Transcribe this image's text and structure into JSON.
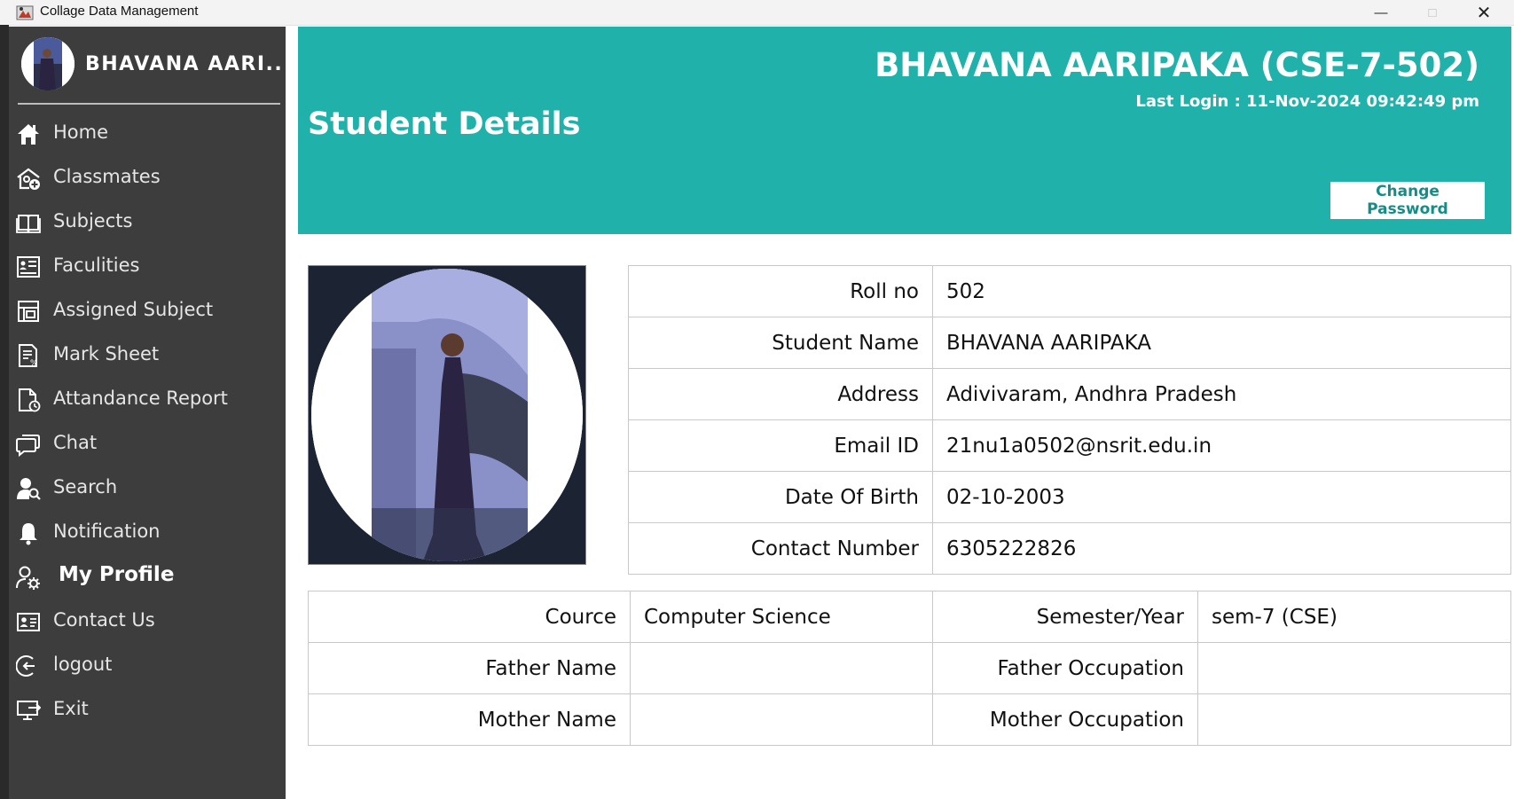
{
  "window": {
    "title": "Collage Data Management"
  },
  "sidebar": {
    "user_name": "BHAVANA AARI...",
    "items": [
      {
        "label": "Home",
        "icon": "home-icon"
      },
      {
        "label": "Classmates",
        "icon": "classmates-icon"
      },
      {
        "label": "Subjects",
        "icon": "book-icon"
      },
      {
        "label": "Faculities",
        "icon": "faculty-list-icon"
      },
      {
        "label": "Assigned Subject",
        "icon": "assigned-subject-icon"
      },
      {
        "label": "Mark Sheet",
        "icon": "mark-sheet-icon"
      },
      {
        "label": "Attandance Report",
        "icon": "report-icon"
      },
      {
        "label": "Chat",
        "icon": "chat-icon"
      },
      {
        "label": "Search",
        "icon": "user-search-icon"
      },
      {
        "label": "Notification",
        "icon": "bell-icon"
      },
      {
        "label": "My Profile",
        "icon": "user-settings-icon",
        "active": true
      },
      {
        "label": "Contact Us",
        "icon": "contact-card-icon"
      },
      {
        "label": "logout",
        "icon": "logout-icon"
      },
      {
        "label": "Exit",
        "icon": "exit-icon"
      }
    ]
  },
  "header": {
    "student_title": "BHAVANA AARIPAKA (CSE-7-502)",
    "last_login": "Last Login : 11-Nov-2024 09:42:49 pm",
    "page_title": "Student Details",
    "change_password_label": "Change Password",
    "accent_color": "#20b2aa"
  },
  "details": [
    {
      "label": "Roll no",
      "value": "502"
    },
    {
      "label": "Student Name",
      "value": "BHAVANA AARIPAKA"
    },
    {
      "label": "Address",
      "value": "Adivivaram, Andhra Pradesh"
    },
    {
      "label": "Email ID",
      "value": "21nu1a0502@nsrit.edu.in"
    },
    {
      "label": "Date Of Birth",
      "value": "02-10-2003"
    },
    {
      "label": "Contact Number",
      "value": "6305222826"
    }
  ],
  "family": [
    {
      "label1": "Cource",
      "value1": "Computer Science",
      "label2": "Semester/Year",
      "value2": "sem-7  (CSE)"
    },
    {
      "label1": "Father Name",
      "value1": "",
      "label2": "Father Occupation",
      "value2": ""
    },
    {
      "label1": "Mother Name",
      "value1": "",
      "label2": "Mother Occupation",
      "value2": ""
    }
  ]
}
